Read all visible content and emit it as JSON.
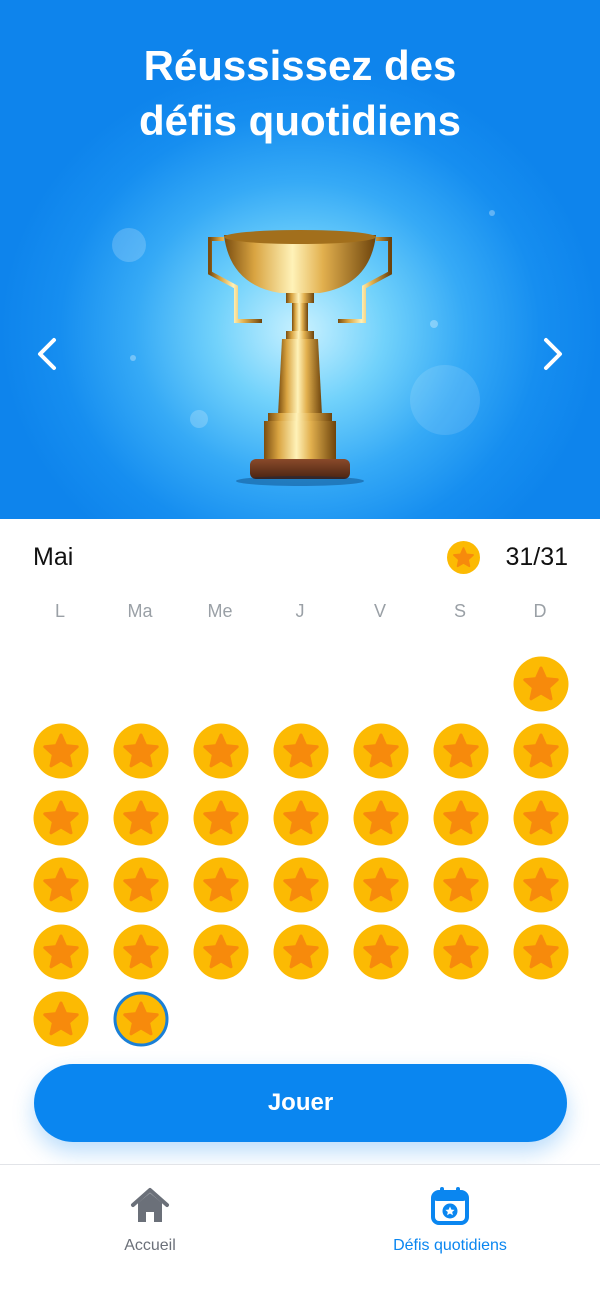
{
  "header": {
    "title_line1": "Réussissez des",
    "title_line2": "défis quotidiens",
    "prev_icon": "chevron-left-icon",
    "next_icon": "chevron-right-icon",
    "hero_image": "trophy-icon"
  },
  "calendar": {
    "month": "Mai",
    "score": "31/31",
    "score_icon": "star-coin-icon",
    "weekdays": [
      "L",
      "Ma",
      "Me",
      "J",
      "V",
      "S",
      "D"
    ],
    "first_weekday_index": 6,
    "days_in_month": 31,
    "completed_days": 31,
    "selected_day": 31,
    "colors": {
      "coin": "#fcba03",
      "star": "#f78a0c",
      "selected_ring": "#1a7fd6"
    }
  },
  "actions": {
    "play_label": "Jouer",
    "accent": "#0a86f0"
  },
  "tabbar": {
    "home_label": "Accueil",
    "home_icon": "home-icon",
    "daily_label": "Défis quotidiens",
    "daily_icon": "calendar-star-icon",
    "active_tab": "Défis quotidiens",
    "active_color": "#0a86f0",
    "inactive_color": "#6b7079"
  }
}
